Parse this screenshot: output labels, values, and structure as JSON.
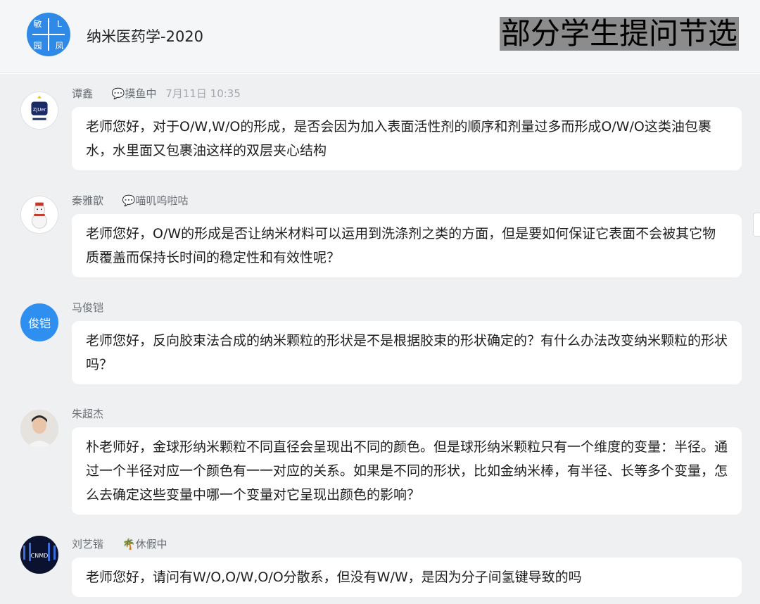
{
  "header": {
    "group_avatar": [
      "敏",
      "L",
      "园",
      "凤"
    ],
    "group_name": "纳米医药学-2020",
    "banner": "部分学生提问节选"
  },
  "messages": [
    {
      "name": "谭鑫",
      "status": "💬摸鱼中",
      "time": "7月11日 10:35",
      "avatar_text": "ZJUer",
      "avatar_color": "#ffffff",
      "text": "老师您好，对于O/W,W/O的形成，是否会因为加入表面活性剂的顺序和剂量过多而形成O/W/O这类油包裹水，水里面又包裹油这样的双层夹心结构"
    },
    {
      "name": "秦雅歆",
      "status": "💬喵叽呜啦咕",
      "time": "",
      "avatar_text": "",
      "avatar_color": "#ffffff",
      "text": "老师您好，O/W的形成是否让纳米材料可以运用到洗涤剂之类的方面，但是要如何保证它表面不会被其它物质覆盖而保持长时间的稳定性和有效性呢？"
    },
    {
      "name": "马俊铠",
      "status": "",
      "time": "",
      "avatar_text": "俊铠",
      "avatar_color": "#2f8ff0",
      "text": "老师您好，反向胶束法合成的纳米颗粒的形状是不是根据胶束的形状确定的？有什么办法改变纳米颗粒的形状吗？"
    },
    {
      "name": "朱超杰",
      "status": "",
      "time": "",
      "avatar_text": "",
      "avatar_color": "#d9d4cf",
      "text": "朴老师好，金球形纳米颗粒不同直径会呈现出不同的颜色。但是球形纳米颗粒只有一个维度的变量：半径。通过一个半径对应一个颜色有一一对应的关系。如果是不同的形状，比如金纳米棒，有半径、长等多个变量，怎么去确定这些变量中哪一个变量对它呈现出颜色的影响？"
    },
    {
      "name": "刘艺锴",
      "status": "🌴休假中",
      "time": "",
      "avatar_text": "CNMD",
      "avatar_color": "#0b1230",
      "text": "老师您好，请问有W/O,O/W,O/O分散系，但没有W/W，是因为分子间氢键导致的吗"
    }
  ]
}
